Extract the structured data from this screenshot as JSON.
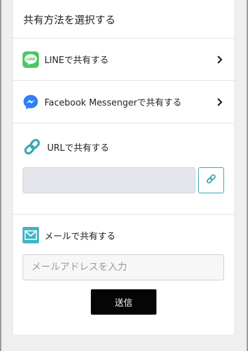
{
  "header": {
    "title": "共有方法を選択する"
  },
  "share_options": {
    "line": {
      "label": "LINEで共有する",
      "icon": "line-icon",
      "icon_text": "LINE",
      "color": "#4cc764"
    },
    "messenger": {
      "label": "Facebook Messengerで共有する",
      "icon": "messenger-icon",
      "color": "#2f7ef5"
    }
  },
  "url_share": {
    "label": "URLで共有する",
    "icon": "link-icon",
    "color": "#3aa6b5",
    "value": "",
    "copy_icon": "link-icon"
  },
  "mail_share": {
    "label": "メールで共有する",
    "icon": "mail-icon",
    "color": "#3fb6c6",
    "placeholder": "メールアドレスを入力",
    "send_label": "送信"
  }
}
